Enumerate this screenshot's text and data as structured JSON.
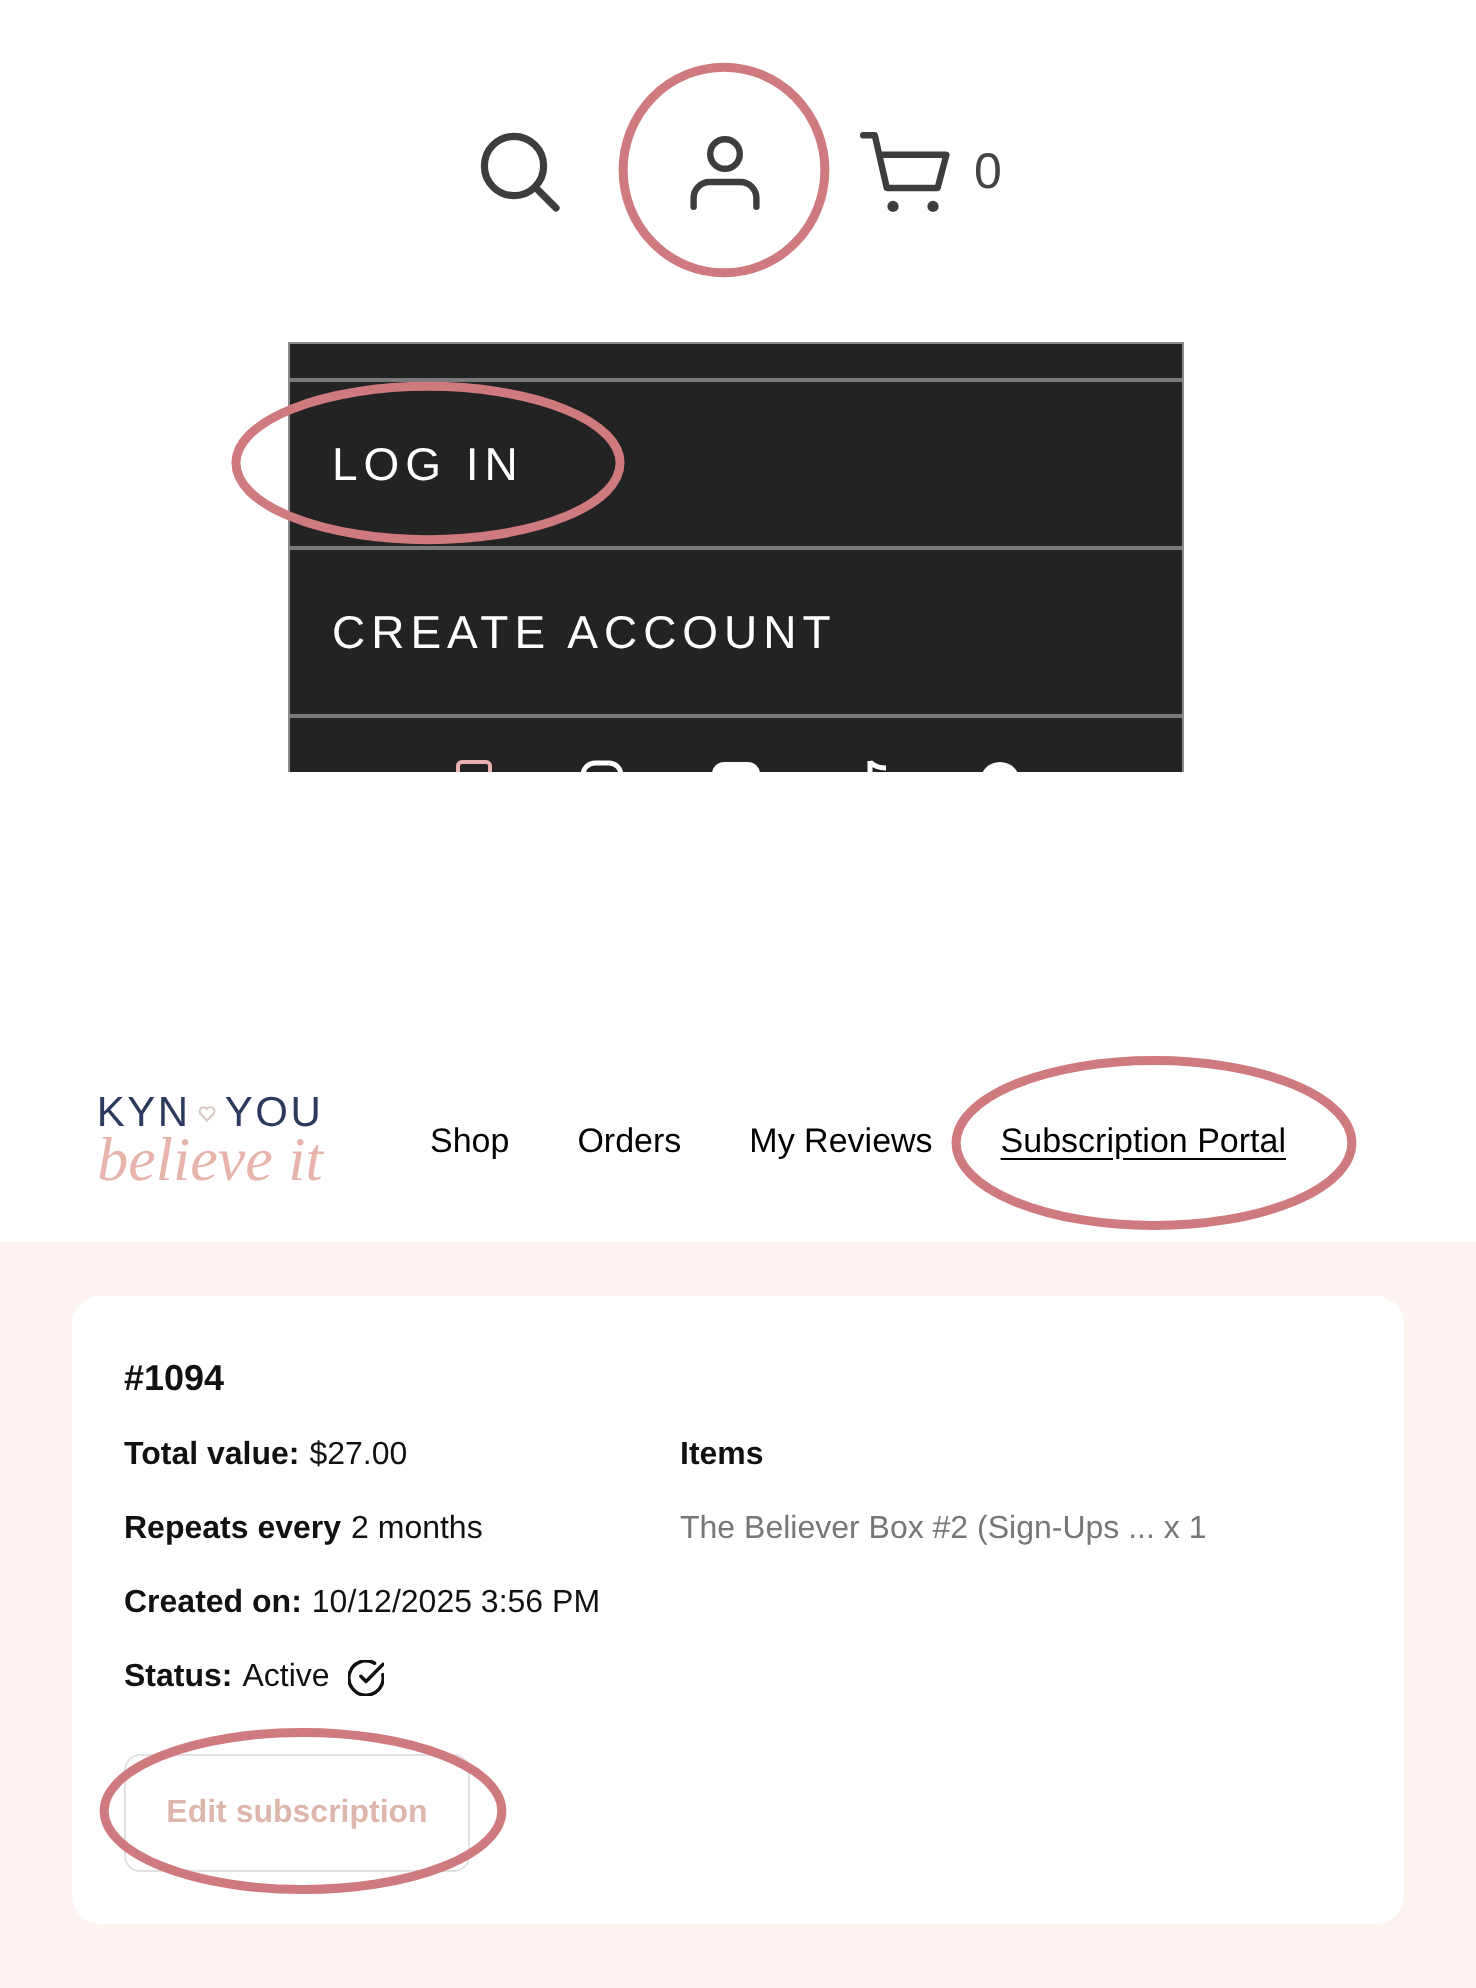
{
  "header_icons": [
    {
      "kind": "search",
      "highlighted": false
    },
    {
      "kind": "account",
      "highlighted": true
    },
    {
      "kind": "cart",
      "highlighted": false,
      "count": "0"
    }
  ],
  "account_menu": {
    "items": [
      {
        "label": "LOG IN",
        "highlighted": true
      },
      {
        "label": "CREATE ACCOUNT",
        "highlighted": false
      }
    ]
  },
  "site_header": {
    "logo": {
      "word_1": "KYN",
      "word_2": "YOU",
      "tagline": "believe it"
    },
    "nav": [
      {
        "label": "Shop",
        "selected": false,
        "highlighted": false
      },
      {
        "label": "Orders",
        "selected": false,
        "highlighted": false
      },
      {
        "label": "My Reviews",
        "selected": false,
        "highlighted": false
      },
      {
        "label": "Subscription Portal",
        "selected": true,
        "highlighted": true
      }
    ]
  },
  "subscription": {
    "number": "#1094",
    "fields": [
      {
        "kind": "text",
        "label": "Total value:",
        "value": "$27.00"
      },
      {
        "kind": "text",
        "label": "Repeats every",
        "value": "2 months"
      },
      {
        "kind": "text",
        "label": "Created on:",
        "value": "10/12/2025 3:56 PM"
      },
      {
        "kind": "status",
        "label": "Status:",
        "value": "Active"
      }
    ],
    "items_heading": "Items",
    "items": [
      "The Believer Box #2 (Sign-Ups ... x 1"
    ],
    "button": {
      "label": "Edit subscription",
      "highlighted": true
    }
  }
}
